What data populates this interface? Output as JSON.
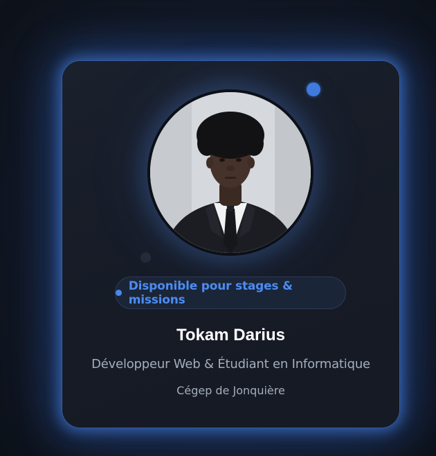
{
  "profile": {
    "name": "Tokam Darius",
    "role": "Développeur Web & Étudiant en Informatique",
    "school": "Cégep de Jonquière",
    "availability": "Disponible pour stages & missions",
    "photo_icon": "profile-photo"
  },
  "colors": {
    "accent": "#3f7ce0",
    "badge_text": "#4c8cf0",
    "card_bg": "#1a202c",
    "page_bg": "#0f141d",
    "glow": "#4682e6"
  }
}
